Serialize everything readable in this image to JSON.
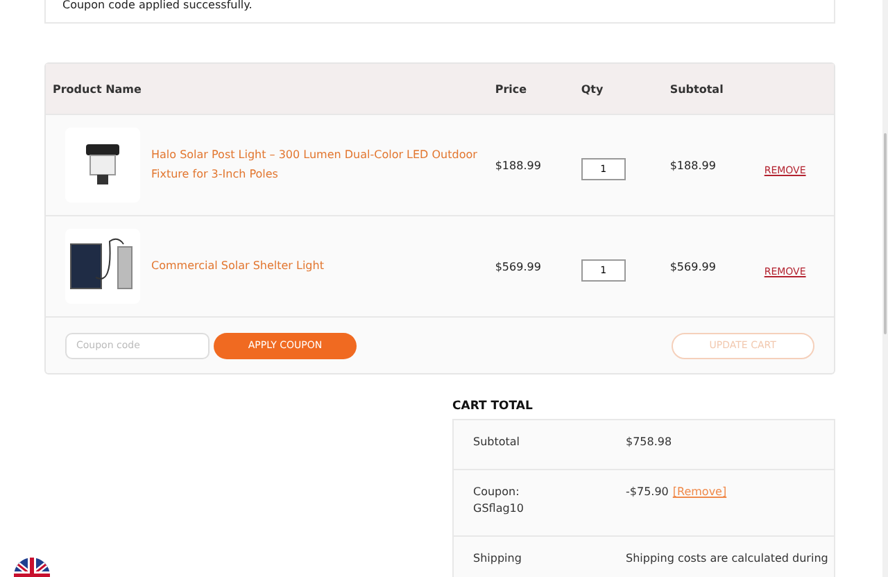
{
  "notice": {
    "text": "Coupon code applied successfully."
  },
  "cart_table": {
    "columns": [
      "Product Name",
      "Price",
      "Qty",
      "Subtotal"
    ],
    "rows": [
      {
        "product": "Halo Solar Post Light – 300 Lumen Dual-Color LED Outdoor Fixture for 3-Inch Poles",
        "kind": "post-light",
        "price": "$188.99",
        "qty": "1",
        "subtotal": "$188.99",
        "remove": "REMOVE"
      },
      {
        "product": "Commercial Solar Shelter Light",
        "kind": "shelter-light",
        "price": "$569.99",
        "qty": "1",
        "subtotal": "$569.99",
        "remove": "REMOVE"
      }
    ],
    "coupon": {
      "placeholder": "Coupon code",
      "apply": "APPLY COUPON",
      "update": "UPDATE CART",
      "update_disabled": true
    }
  },
  "cart_total": {
    "title": "CART TOTAL",
    "rows": [
      {
        "label": "Subtotal",
        "value": "$758.98"
      },
      {
        "label": "Coupon: GSflag10",
        "value": "-$75.90",
        "link": "[Remove]"
      },
      {
        "label": "Shipping",
        "value": "Shipping costs are calculated during"
      }
    ]
  }
}
